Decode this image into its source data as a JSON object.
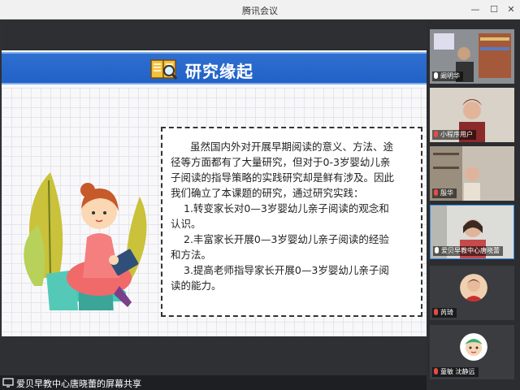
{
  "window": {
    "title": "腾讯会议",
    "controls": [
      "—",
      "☐",
      "✕"
    ]
  },
  "slide": {
    "heading": "研究缘起",
    "paragraph_lines": [
      "虽然国内外对开展早期阅读的意义、方法、途",
      "径等方面都有了大量研究，但对于0-3岁婴幼儿亲",
      "子阅读的指导策略的实践研究却是鲜有涉及。因此",
      "我们确立了本课题的研究，通过研究实践：",
      "1.转变家长对0—3岁婴幼儿亲子阅读的观念和",
      "认识。",
      "2.丰富家长开展0—3岁婴幼儿亲子阅读的经验",
      "和方法。",
      "3.提高老师指导家长开展0—3岁婴幼儿亲子阅",
      "读的能力。"
    ]
  },
  "share_bar": {
    "label": "爱贝早教中心唐晓蕾的屏幕共享"
  },
  "participants": [
    {
      "name": "阚明华",
      "mic": "on",
      "icon": "user-icon"
    },
    {
      "name": "小程序用户",
      "mic": "off",
      "icon": ""
    },
    {
      "name": "殷华",
      "mic": "off",
      "icon": ""
    },
    {
      "name": "爱贝早教中心唐晓蕾",
      "mic": "on",
      "icon": ""
    },
    {
      "name": "芮琦",
      "mic": "off",
      "icon": ""
    },
    {
      "name": "童敏 沈静远",
      "mic": "off",
      "icon": ""
    }
  ],
  "colors": {
    "banner": "#2261c6",
    "window_bg": "#2b2d31",
    "active_border": "#3a8ee6"
  }
}
